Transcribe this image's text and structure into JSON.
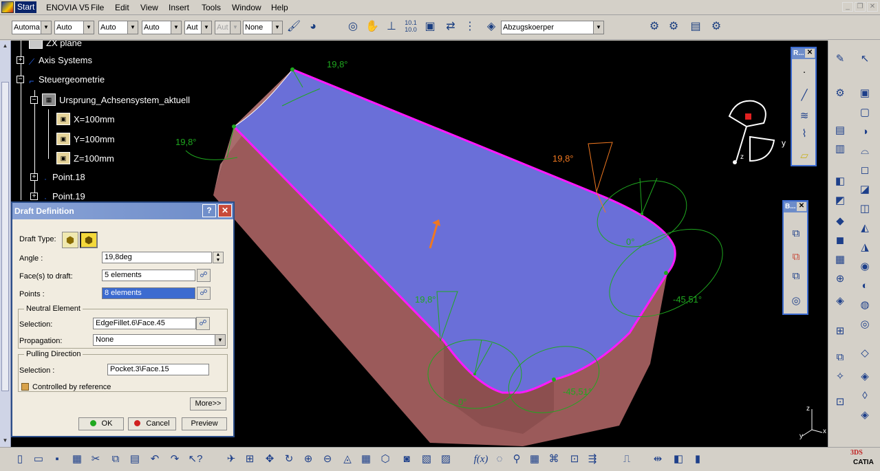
{
  "menubar": {
    "items": [
      "Start",
      "ENOVIA V5",
      "File",
      "Edit",
      "View",
      "Insert",
      "Tools",
      "Window",
      "Help"
    ]
  },
  "toolbar": {
    "combos": [
      "Automa",
      "Auto",
      "Auto",
      "Auto",
      "Aut",
      "Aut",
      "None"
    ],
    "current_body": "Abzugskoerper"
  },
  "tree": {
    "items": [
      {
        "label": "ZX plane"
      },
      {
        "label": "Axis Systems"
      },
      {
        "label": "Steuergeometrie"
      },
      {
        "label": "Ursprung_Achsensystem_aktuell"
      },
      {
        "label": "X=100mm"
      },
      {
        "label": "Y=100mm"
      },
      {
        "label": "Z=100mm"
      },
      {
        "label": "Point.18"
      },
      {
        "label": "Point.19"
      }
    ]
  },
  "viewport": {
    "annotations": [
      "19,8°",
      "19,8°",
      "19,8°",
      "19,8°",
      "-45,51°",
      "-45,51°",
      "0°",
      "0°"
    ],
    "compass_y": "y",
    "compass_z": "z",
    "axis_x": "x",
    "axis_y": "y",
    "axis_z": "z"
  },
  "dialog": {
    "title": "Draft Definition",
    "help": "?",
    "close": "✕",
    "draft_type_label": "Draft Type:",
    "angle_label": "Angle :",
    "angle_value": "19,8deg",
    "faces_label": "Face(s) to draft:",
    "faces_value": "5 elements",
    "points_label": "Points :",
    "points_value": "8 elements",
    "neutral_group": "Neutral Element",
    "neutral_selection_label": "Selection:",
    "neutral_selection_value": "EdgeFillet.6\\Face.45",
    "propagation_label": "Propagation:",
    "propagation_value": "None",
    "pulling_group": "Pulling Direction",
    "pulling_selection_label": "Selection :",
    "pulling_selection_value": "Pocket.3\\Face.15",
    "controlled_label": "Controlled by reference",
    "more": "More>>",
    "ok": "OK",
    "cancel": "Cancel",
    "preview": "Preview"
  },
  "panels": {
    "r_title": "R...",
    "b_title": "B..."
  },
  "brand": {
    "name": "CATIA",
    "mark": "3DS"
  },
  "colors": {
    "background": "#000000",
    "top_face": "#6a6fd8",
    "side_face": "#9b5a5a",
    "edge": "#ff19ff",
    "annotation": "#1fa81f",
    "highlight": "#f07820"
  }
}
